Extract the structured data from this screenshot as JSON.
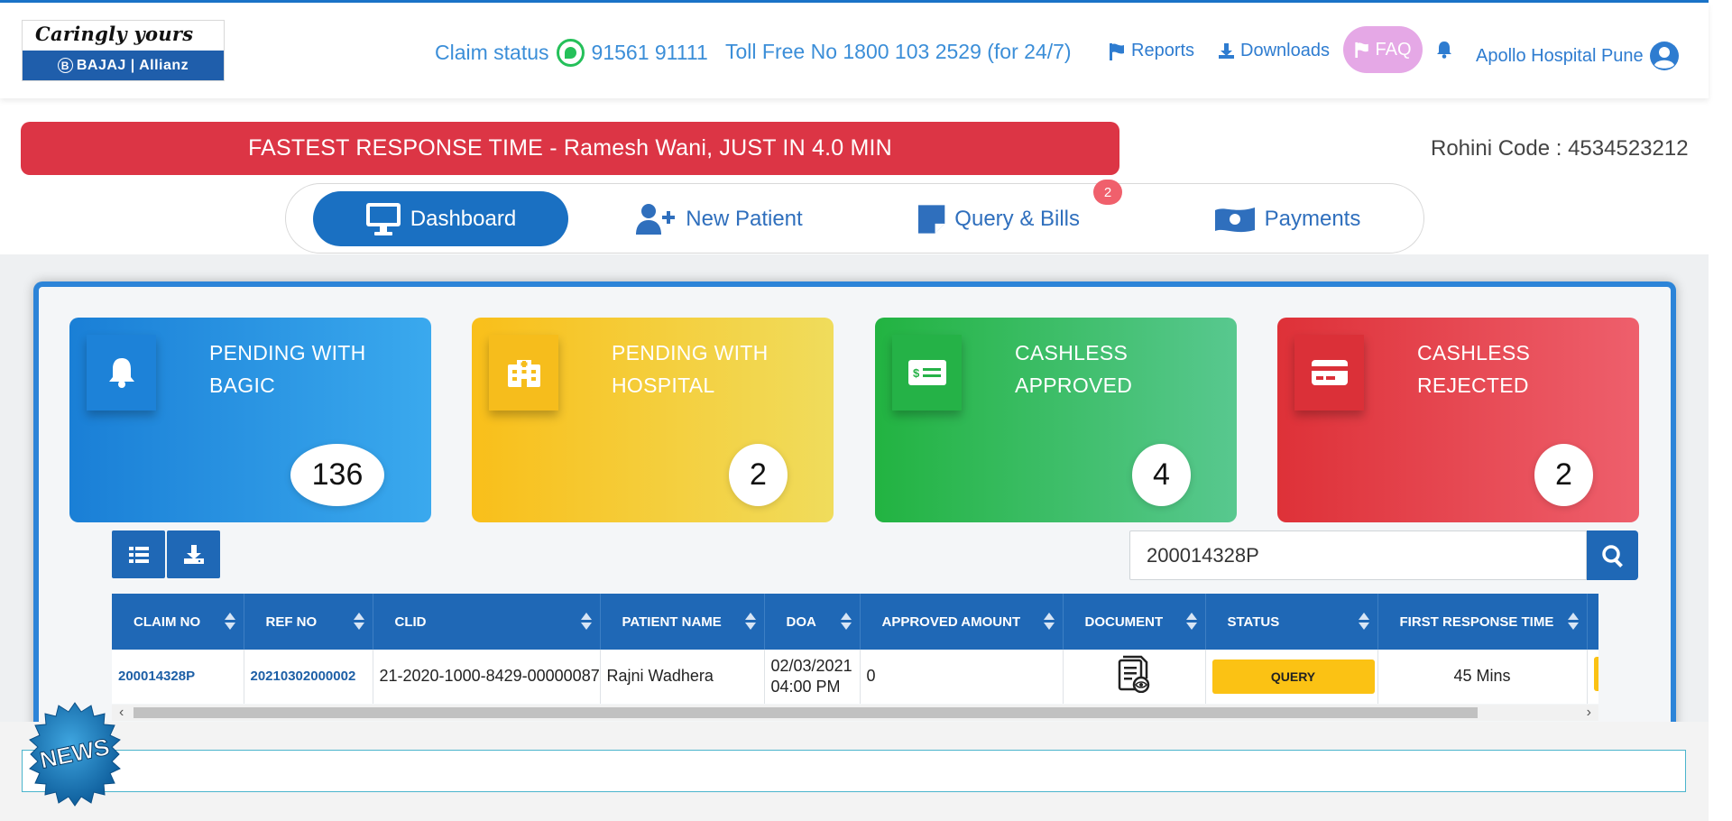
{
  "logo": {
    "tagline": "Caringly yours",
    "brand": "BAJAJ | Allianz",
    "brand_mark": "B"
  },
  "header": {
    "claim_status_label": "Claim status",
    "claim_status_number": "91561 91111",
    "tollfree": "Toll Free No 1800 103 2529 (for 24/7)",
    "reports": "Reports",
    "downloads": "Downloads",
    "faq": "FAQ",
    "hospital": "Apollo Hospital Pune"
  },
  "banner": {
    "text": "FASTEST RESPONSE TIME - Ramesh Wani, JUST IN 4.0 MIN",
    "rohini": "Rohini Code : 4534523212"
  },
  "tabs": [
    {
      "label": "Dashboard",
      "icon": "monitor-icon",
      "active": true
    },
    {
      "label": "New Patient",
      "icon": "user-plus-icon",
      "active": false
    },
    {
      "label": "Query & Bills",
      "icon": "note-icon",
      "active": false,
      "badge": "2"
    },
    {
      "label": "Payments",
      "icon": "money-bill-icon",
      "active": false
    }
  ],
  "cards": [
    {
      "title": "PENDING WITH BAGIC",
      "count": "136",
      "icon": "bell-icon",
      "color": "#1a7fd6"
    },
    {
      "title": "PENDING WITH HOSPITAL",
      "count": "2",
      "icon": "hospital-icon",
      "color": "#f9bf1a"
    },
    {
      "title": "CASHLESS APPROVED",
      "count": "4",
      "icon": "money-check-icon",
      "color": "#22b341"
    },
    {
      "title": "CASHLESS REJECTED",
      "count": "2",
      "icon": "credit-card-icon",
      "color": "#de3138"
    }
  ],
  "search": {
    "value": "200014328P"
  },
  "table": {
    "columns": [
      "CLAIM NO",
      "REF NO",
      "CLID",
      "PATIENT NAME",
      "DOA",
      "APPROVED AMOUNT",
      "DOCUMENT",
      "STATUS",
      "FIRST RESPONSE TIME"
    ],
    "rows": [
      {
        "claim_no": "200014328P",
        "ref_no": "20210302000002",
        "clid": "21-2020-1000-8429-00000087",
        "patient_name": "Rajni Wadhera",
        "doa_date": "02/03/2021",
        "doa_time": "04:00 PM",
        "approved_amount": "0",
        "status": "QUERY",
        "first_response_time": "45 Mins"
      }
    ]
  },
  "news": {
    "badge": "NEWS"
  }
}
